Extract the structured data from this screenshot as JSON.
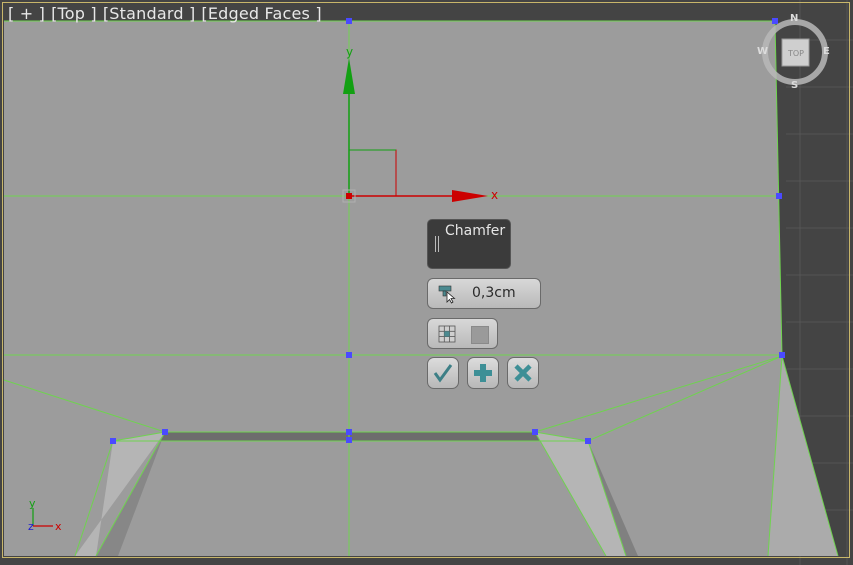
{
  "viewport": {
    "labels": [
      "[ + ]",
      "[Top ]",
      "[Standard ]",
      "[Edged Faces ]"
    ],
    "colors": {
      "background": "#444444",
      "face": "#9c9c9c",
      "edge": "#6fd34f",
      "vertex": "#3a3aff",
      "x_axis": "#cc0000",
      "y_axis": "#12a012"
    }
  },
  "gizmo": {
    "x_label": "x",
    "y_label": "y"
  },
  "world_axes": {
    "x_label": "x",
    "y_label": "y",
    "z_label": "z"
  },
  "viewcube": {
    "face_label": "TOP",
    "north": "N",
    "south": "S",
    "east": "E",
    "west": "W"
  },
  "caddy": {
    "title": "Chamfer",
    "amount_value": "0,3cm",
    "buttons": {
      "ok_icon": "checkmark-icon",
      "apply_icon": "plus-icon",
      "cancel_icon": "x-icon"
    }
  }
}
